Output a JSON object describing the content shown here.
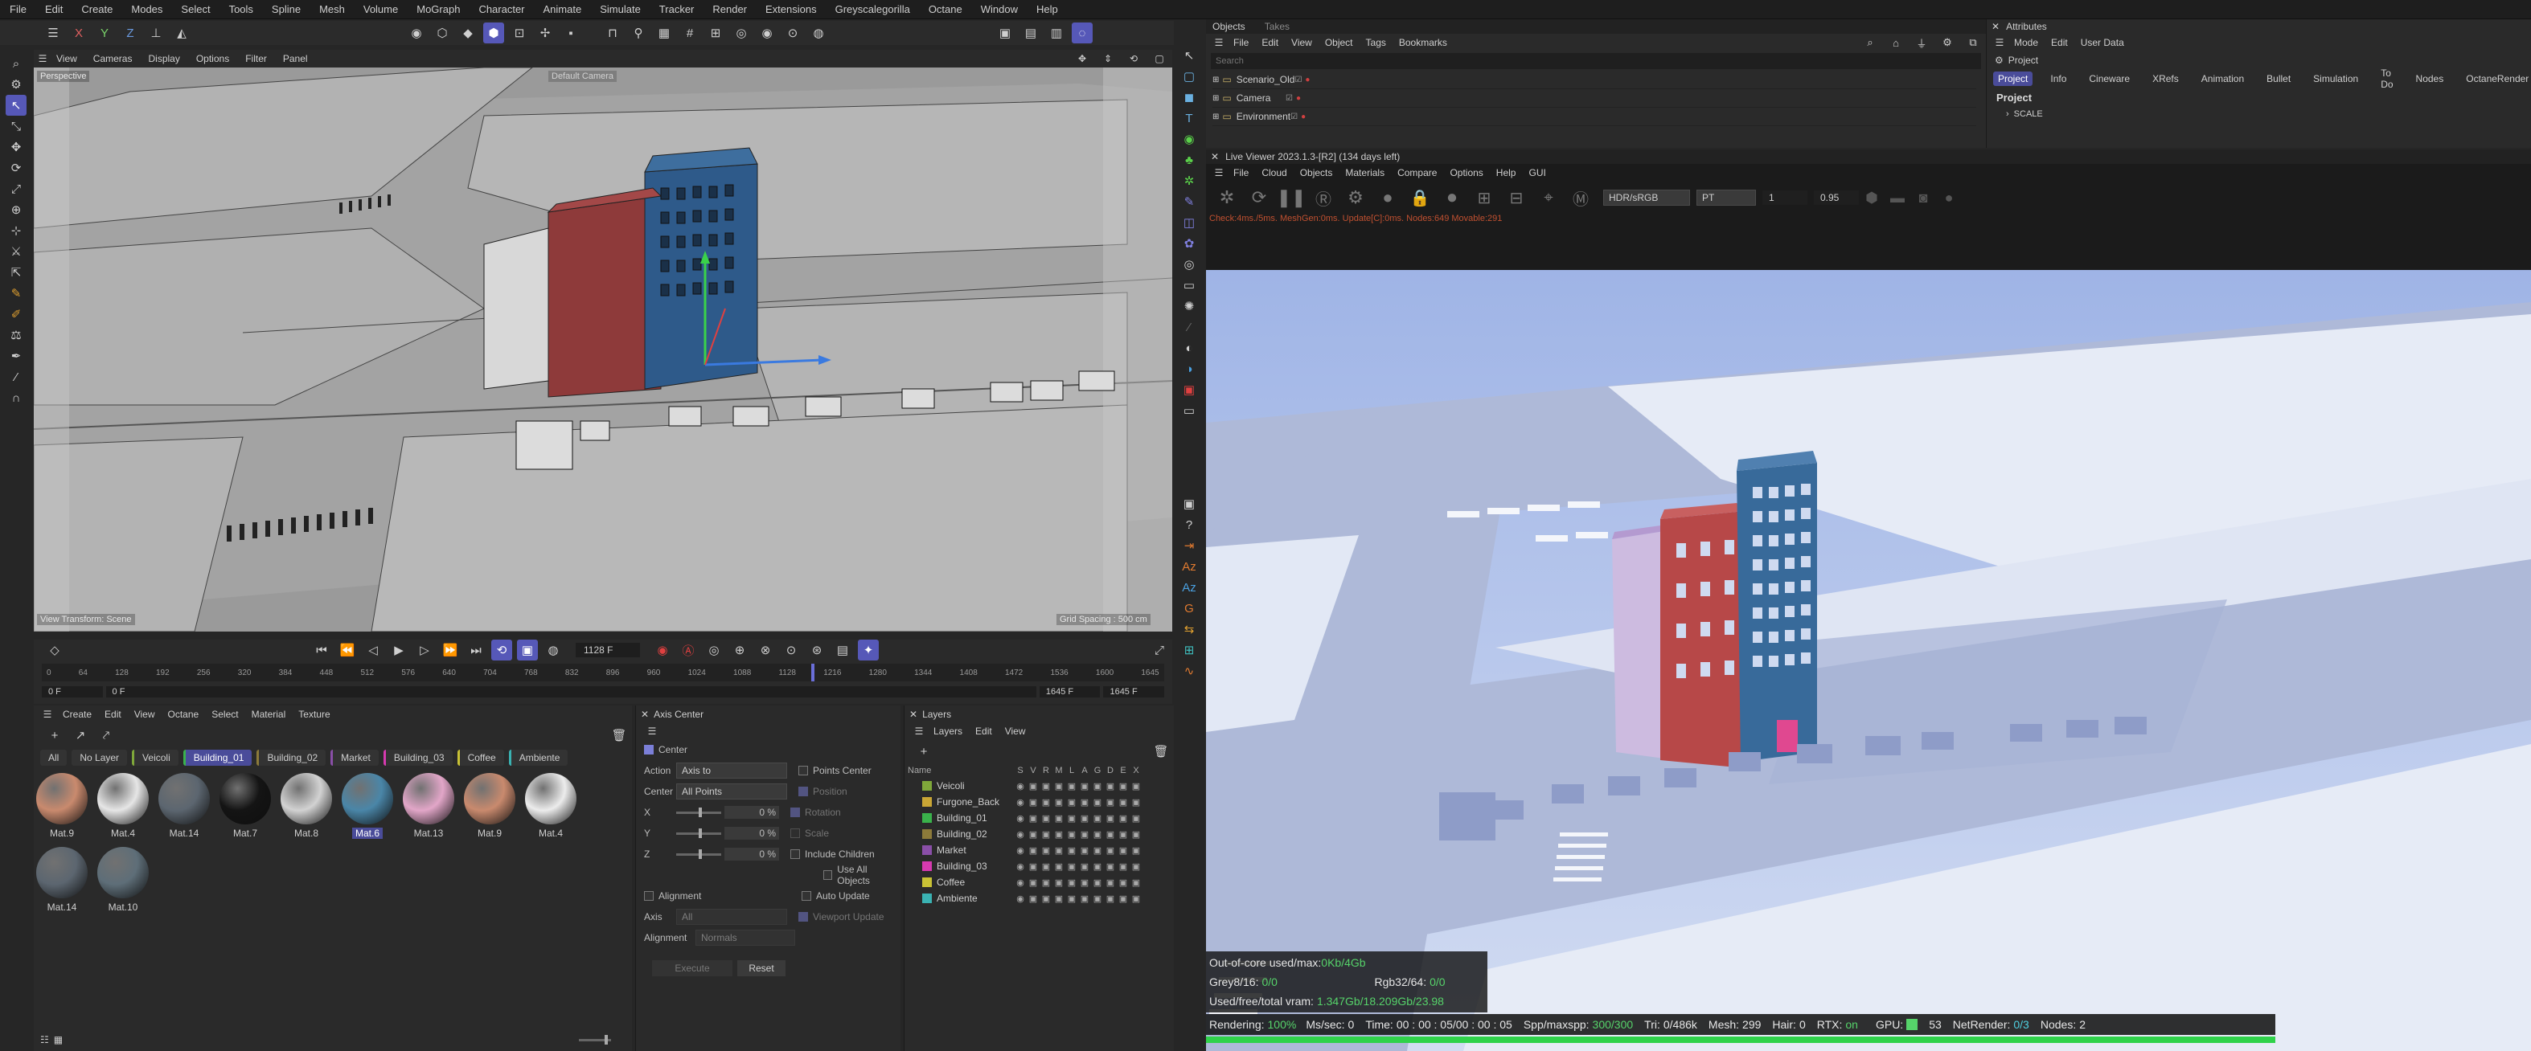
{
  "menu": [
    "File",
    "Edit",
    "Create",
    "Modes",
    "Select",
    "Tools",
    "Spline",
    "Mesh",
    "Volume",
    "MoGraph",
    "Character",
    "Animate",
    "Simulate",
    "Tracker",
    "Render",
    "Extensions",
    "Greyscalegorilla",
    "Octane",
    "Window",
    "Help"
  ],
  "viewport": {
    "menu": [
      "View",
      "Cameras",
      "Display",
      "Options",
      "Filter",
      "Panel"
    ],
    "label": "Perspective",
    "camera_label": "Default Camera",
    "view_transform": "View Transform: Scene",
    "grid_spacing": "Grid Spacing : 500 cm"
  },
  "timeline": {
    "current_frame": "1128 F",
    "start": "0 F",
    "start2": "0 F",
    "end": "1645 F",
    "end2": "1645 F",
    "ticks": [
      "0",
      "64",
      "128",
      "192",
      "256",
      "320",
      "384",
      "448",
      "512",
      "576",
      "640",
      "704",
      "768",
      "832",
      "896",
      "960",
      "1024",
      "1088",
      "1128",
      "1216",
      "1280",
      "1344",
      "1408",
      "1472",
      "1536",
      "1600",
      "1645"
    ]
  },
  "materials": {
    "menu": [
      "Create",
      "Edit",
      "View",
      "Octane",
      "Select",
      "Material",
      "Texture"
    ],
    "filters": [
      "All",
      "No Layer",
      "Veicoli",
      "Building_01",
      "Building_02",
      "Market",
      "Building_03",
      "Coffee",
      "Ambiente"
    ],
    "active_filter": "Building_01",
    "items": [
      {
        "name": "Mat.9",
        "color": "#c98a6e"
      },
      {
        "name": "Mat.4",
        "color": "#e6e6e6"
      },
      {
        "name": "Mat.14",
        "color": "#5c6670"
      },
      {
        "name": "Mat.7",
        "color": "#141414"
      },
      {
        "name": "Mat.8",
        "color": "#d2d2d2"
      },
      {
        "name": "Mat.6",
        "color": "#4a86a8"
      },
      {
        "name": "Mat.13",
        "color": "#e2a6c8"
      },
      {
        "name": "Mat.9",
        "color": "#c98a6e"
      },
      {
        "name": "Mat.4",
        "color": "#ececec"
      },
      {
        "name": "Mat.14",
        "color": "#5c6670"
      },
      {
        "name": "Mat.10",
        "color": "#5e6e78"
      }
    ],
    "selected": "Mat.6"
  },
  "axis_center": {
    "title": "Axis Center",
    "center_label": "Center",
    "action_label": "Action",
    "action_value": "Axis to",
    "center_field_label": "Center",
    "center_value": "All Points",
    "x_label": "X",
    "x_value": "0 %",
    "y_label": "Y",
    "y_value": "0 %",
    "z_label": "Z",
    "z_value": "0 %",
    "alignment_label": "Alignment",
    "axis_label": "Axis",
    "axis_value": "All",
    "alignment_field_label": "Alignment",
    "alignment_value": "Normals",
    "points_center": "Points Center",
    "position": "Position",
    "rotation": "Rotation",
    "scale": "Scale",
    "include_children": "Include Children",
    "use_all_objects": "Use All Objects",
    "auto_update": "Auto Update",
    "viewport_update": "Viewport Update",
    "execute": "Execute",
    "reset": "Reset"
  },
  "layers": {
    "title": "Layers",
    "menu": [
      "Layers",
      "Edit",
      "View"
    ],
    "col_name": "Name",
    "cols": [
      "S",
      "V",
      "R",
      "M",
      "L",
      "A",
      "G",
      "D",
      "E",
      "X"
    ],
    "items": [
      {
        "name": "Veicoli",
        "color": "#7fa83a"
      },
      {
        "name": "Furgone_Back",
        "color": "#c9a635"
      },
      {
        "name": "Building_01",
        "color": "#3ab24b"
      },
      {
        "name": "Building_02",
        "color": "#8c7a3a"
      },
      {
        "name": "Market",
        "color": "#8a4fa8"
      },
      {
        "name": "Building_03",
        "color": "#d63ab0"
      },
      {
        "name": "Coffee",
        "color": "#c9c235"
      },
      {
        "name": "Ambiente",
        "color": "#3ab2b2"
      }
    ]
  },
  "objects": {
    "tabs": [
      "Objects",
      "Takes"
    ],
    "menu": [
      "File",
      "Edit",
      "View",
      "Object",
      "Tags",
      "Bookmarks"
    ],
    "search_placeholder": "Search",
    "items": [
      "Scenario_Old",
      "Camera",
      "Environment"
    ]
  },
  "attributes": {
    "title": "Attributes",
    "menu": [
      "Mode",
      "Edit",
      "User Data"
    ],
    "project": "Project",
    "tabs": [
      "Project",
      "Info",
      "Cineware",
      "XRefs",
      "Animation",
      "Bullet",
      "Simulation",
      "To Do",
      "Nodes",
      "OctaneRender"
    ],
    "section": "Project",
    "scale": "SCALE"
  },
  "live_viewer": {
    "title": "Live Viewer 2023.1.3-[R2] (134 days left)",
    "menu": [
      "File",
      "Cloud",
      "Objects",
      "Materials",
      "Compare",
      "Options",
      "Help",
      "GUI"
    ],
    "color_space": "HDR/sRGB",
    "kernel": "PT",
    "value1": "1",
    "value2": "0.95",
    "debug": "Check:4ms./5ms. MeshGen:0ms. Update[C]:0ms. Nodes:649 Movable:291",
    "ooc_label": "Out-of-core used/max:",
    "ooc_value": "0Kb/4Gb",
    "grey_label": "Grey8/16:",
    "grey_value": "0/0",
    "rgb_label": "Rgb32/64:",
    "rgb_value": "0/0",
    "vram_label": "Used/free/total vram:",
    "vram_value": "1.347Gb/18.209Gb/23.98",
    "status": {
      "rendering_label": "Rendering:",
      "rendering": "100%",
      "ms_label": "Ms/sec:",
      "ms": "0",
      "time_label": "Time:",
      "time": "00 : 00 : 05/00 : 00 : 05",
      "spp_label": "Spp/maxspp:",
      "spp": "300/300",
      "tri_label": "Tri:",
      "tri": "0/486k",
      "mesh_label": "Mesh:",
      "mesh": "299",
      "hair_label": "Hair:",
      "hair": "0",
      "rtx_label": "RTX:",
      "rtx": "on",
      "gpu_label": "GPU:",
      "gpu": "53",
      "netrender_label": "NetRender:",
      "netrender": "0/3",
      "nodes_label": "Nodes:",
      "nodes": "2"
    },
    "progress": 1.0
  }
}
